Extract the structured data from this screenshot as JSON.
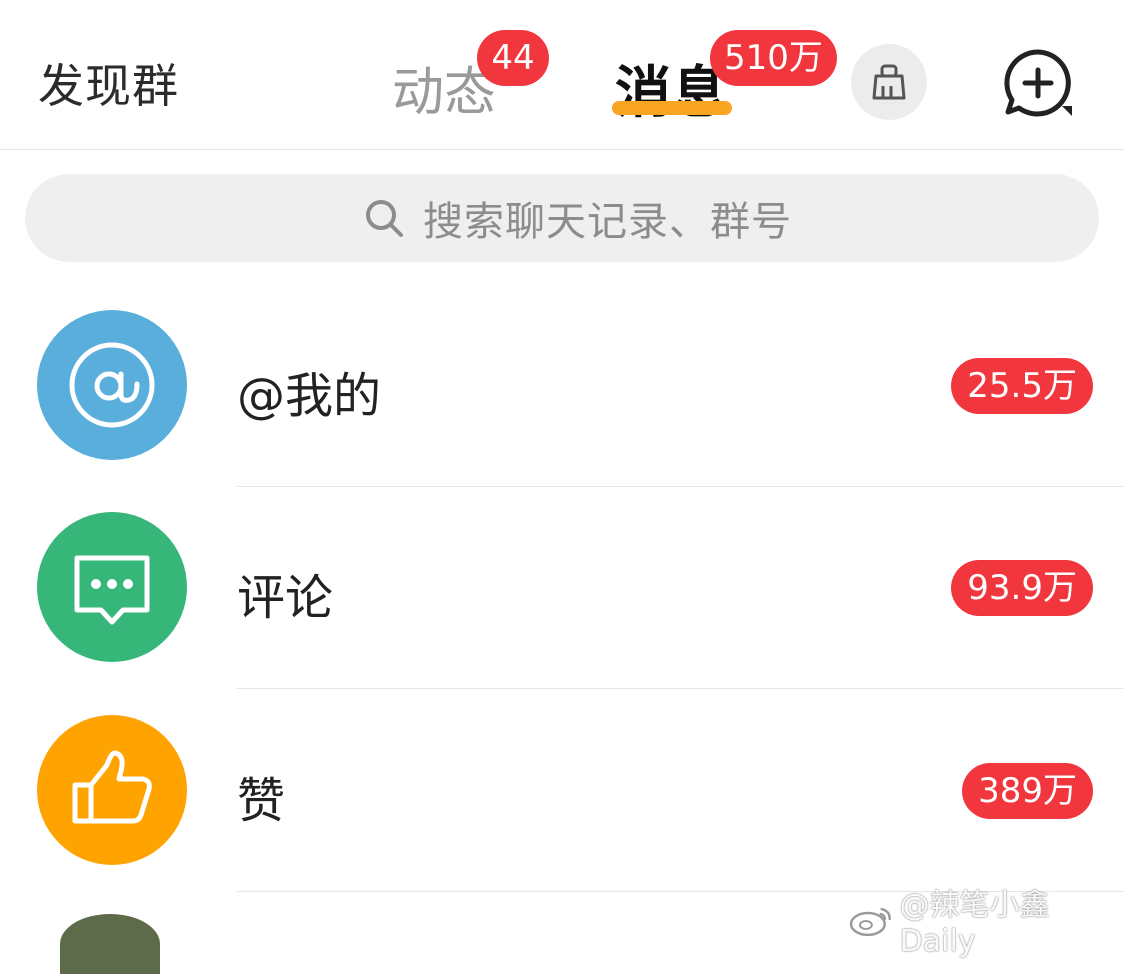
{
  "header": {
    "discover_groups": "发现群",
    "tabs": [
      {
        "label": "动态",
        "badge": "44",
        "active": false
      },
      {
        "label": "消息",
        "badge": "510万",
        "active": true
      }
    ],
    "broom_icon": "broom-icon",
    "new_chat_icon": "chat-plus-icon"
  },
  "search": {
    "placeholder": "搜索聊天记录、群号",
    "icon": "search-icon"
  },
  "messages": [
    {
      "label": "@我的",
      "count": "25.5万",
      "icon": "at-icon",
      "color": "#5aaedc"
    },
    {
      "label": "评论",
      "count": "93.9万",
      "icon": "comment-icon",
      "color": "#36b679"
    },
    {
      "label": "赞",
      "count": "389万",
      "icon": "thumbs-up-icon",
      "color": "#ffa300"
    }
  ],
  "colors": {
    "badge_red": "#f1363d",
    "tab_underline": "#f9a423"
  },
  "watermark": "@辣笔小鑫Daily"
}
